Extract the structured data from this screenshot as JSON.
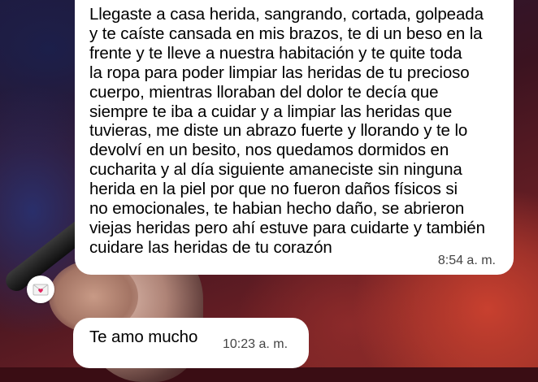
{
  "messages": [
    {
      "text": "Llegaste a casa herida, sangrando, cortada, golpeada\ny te caíste cansada en mis brazos, te di un beso en la\nfrente y te lleve a nuestra habitación y te quite toda\nla ropa para poder limpiar las heridas de tu precioso\ncuerpo, mientras lloraban del dolor te decía que\nsiempre te iba a cuidar y a limpiar las heridas que\ntuvieras, me diste un abrazo fuerte y llorando y te lo\ndevolví en un besito, nos quedamos dormidos en\ncucharita y al día siguiente amaneciste sin ninguna\nherida en la piel por que no fueron daños físicos si\nno emocionales, te habian hecho daño, se abrieron\nviejas heridas pero ahí estuve para cuidarte y también\ncuidare las heridas de tu corazón",
      "time": "8:54 a. m."
    },
    {
      "text": "Te amo mucho",
      "time": "10:23 a. m."
    }
  ],
  "reaction": {
    "icon": "love-letter-icon",
    "color": "#e0245e"
  }
}
